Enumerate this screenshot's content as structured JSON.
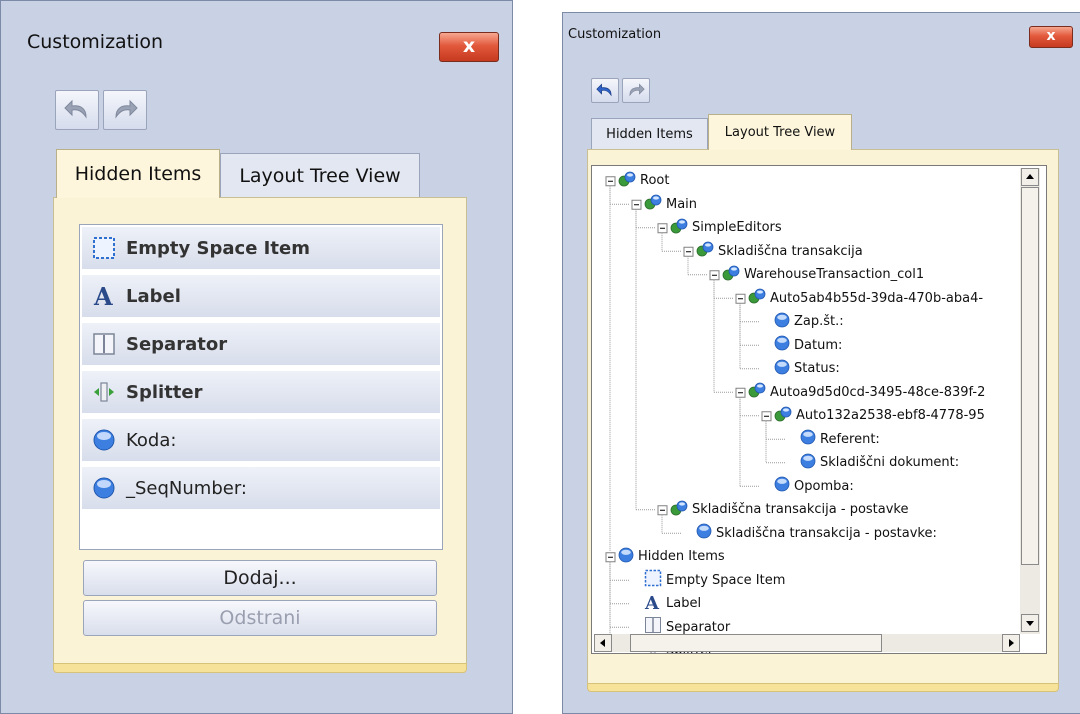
{
  "left_window": {
    "title": "Customization",
    "close_label": "x",
    "toolbar": {
      "undo_icon": "undo-icon",
      "redo_icon": "redo-icon"
    },
    "tabs": [
      {
        "label": "Hidden Items",
        "active": true
      },
      {
        "label": "Layout Tree View",
        "active": false
      }
    ],
    "items": [
      {
        "label": "Empty Space Item",
        "icon": "empty-space-icon",
        "bold": true
      },
      {
        "label": "Label",
        "icon": "label-icon",
        "bold": true
      },
      {
        "label": "Separator",
        "icon": "separator-icon",
        "bold": true
      },
      {
        "label": "Splitter",
        "icon": "splitter-icon",
        "bold": true
      },
      {
        "label": "Koda:",
        "icon": "field-icon",
        "bold": false
      },
      {
        "label": "_SeqNumber:",
        "icon": "field-icon",
        "bold": false
      }
    ],
    "add_button": "Dodaj...",
    "remove_button": "Odstrani"
  },
  "right_window": {
    "title": "Customization",
    "close_label": "x",
    "toolbar": {
      "undo_icon": "undo-icon",
      "redo_icon": "redo-icon"
    },
    "tabs": [
      {
        "label": "Hidden Items",
        "active": false
      },
      {
        "label": "Layout Tree View",
        "active": true
      }
    ],
    "tree": [
      {
        "label": "Root",
        "depth": 0,
        "icon": "group-icon",
        "expander": true
      },
      {
        "label": "Main",
        "depth": 1,
        "icon": "group-icon",
        "expander": true
      },
      {
        "label": "SimpleEditors",
        "depth": 2,
        "icon": "group-icon",
        "expander": true
      },
      {
        "label": "Skladiščna transakcija",
        "depth": 3,
        "icon": "group-icon",
        "expander": true
      },
      {
        "label": "WarehouseTransaction_col1",
        "depth": 4,
        "icon": "group-icon",
        "expander": true
      },
      {
        "label": "Auto5ab4b55d-39da-470b-aba4-",
        "depth": 5,
        "icon": "group-icon",
        "expander": true
      },
      {
        "label": "Zap.št.:",
        "depth": 6,
        "icon": "field-icon",
        "expander": false
      },
      {
        "label": "Datum:",
        "depth": 6,
        "icon": "field-icon",
        "expander": false
      },
      {
        "label": "Status:",
        "depth": 6,
        "icon": "field-icon",
        "expander": false
      },
      {
        "label": "Autoa9d5d0cd-3495-48ce-839f-2",
        "depth": 5,
        "icon": "group-icon",
        "expander": true
      },
      {
        "label": "Auto132a2538-ebf8-4778-95",
        "depth": 6,
        "icon": "group-icon",
        "expander": true
      },
      {
        "label": "Referent:",
        "depth": 7,
        "icon": "field-icon",
        "expander": false
      },
      {
        "label": "Skladiščni dokument:",
        "depth": 7,
        "icon": "field-icon",
        "expander": false
      },
      {
        "label": "Opomba:",
        "depth": 6,
        "icon": "field-icon",
        "expander": false
      },
      {
        "label": "Skladiščna transakcija - postavke",
        "depth": 2,
        "icon": "group-icon",
        "expander": true
      },
      {
        "label": "Skladiščna transakcija - postavke:",
        "depth": 3,
        "icon": "field-icon",
        "expander": false
      },
      {
        "label": "Hidden Items",
        "depth": 0,
        "icon": "field-icon",
        "expander": true
      },
      {
        "label": "Empty Space Item",
        "depth": 1,
        "icon": "empty-space-icon",
        "expander": false
      },
      {
        "label": "Label",
        "depth": 1,
        "icon": "label-icon",
        "expander": false
      },
      {
        "label": "Separator",
        "depth": 1,
        "icon": "separator-icon",
        "expander": false
      },
      {
        "label": "Splitter",
        "depth": 1,
        "icon": "splitter-icon",
        "expander": false
      }
    ]
  }
}
